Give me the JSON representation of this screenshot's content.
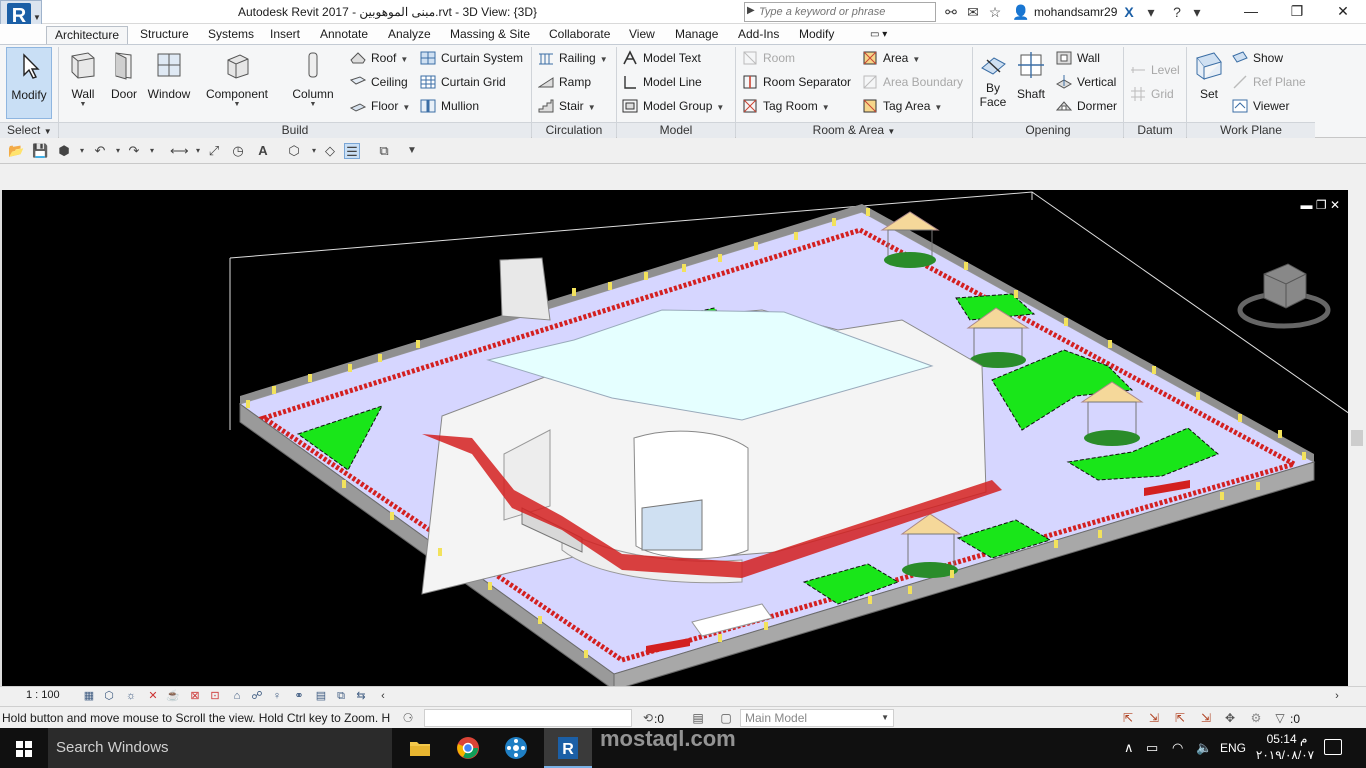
{
  "titlebar": {
    "title": "Autodesk Revit 2017 -     مبنى الموهوبين.rvt - 3D View: {3D}",
    "search_placeholder": "Type a keyword or phrase",
    "user": "mohandsamr29",
    "icons": [
      "binoculars-icon",
      "star-icon",
      "user-icon",
      "exchange-icon",
      "help-icon"
    ]
  },
  "ribbon": {
    "tabs": [
      "Architecture",
      "Structure",
      "Systems",
      "Insert",
      "Annotate",
      "Analyze",
      "Massing & Site",
      "Collaborate",
      "View",
      "Manage",
      "Add-Ins",
      "Modify"
    ],
    "active_tab": "Architecture",
    "select": {
      "modify": "Modify",
      "select": "Select"
    },
    "build": {
      "title": "Build",
      "wall": "Wall",
      "door": "Door",
      "window": "Window",
      "component": "Component",
      "column": "Column",
      "roof": "Roof",
      "ceiling": "Ceiling",
      "floor": "Floor",
      "curtain_system": "Curtain System",
      "curtain_grid": "Curtain Grid",
      "mullion": "Mullion"
    },
    "circulation": {
      "title": "Circulation",
      "railing": "Railing",
      "ramp": "Ramp",
      "stair": "Stair"
    },
    "model": {
      "title": "Model",
      "model_text": "Model Text",
      "model_line": "Model Line",
      "model_group": "Model Group"
    },
    "room_area": {
      "title": "Room & Area",
      "room": "Room",
      "room_separator": "Room Separator",
      "tag_room": "Tag Room",
      "area": "Area",
      "area_boundary": "Area Boundary",
      "tag_area": "Tag Area"
    },
    "opening": {
      "title": "Opening",
      "by_face": "By Face",
      "by_face_2": "Face",
      "by_face_1": "By",
      "shaft": "Shaft",
      "wall": "Wall",
      "vertical": "Vertical",
      "dormer": "Dormer"
    },
    "datum": {
      "title": "Datum",
      "level": "Level",
      "grid": "Grid"
    },
    "work_plane": {
      "title": "Work Plane",
      "set": "Set",
      "show": "Show",
      "ref_plane": "Ref Plane",
      "viewer": "Viewer"
    }
  },
  "view_control": {
    "scale": "1 : 100"
  },
  "status": {
    "message": "Hold button and move mouse to Scroll the view. Hold Ctrl key to Zoom. H",
    "coord": ":0",
    "model": "Main Model",
    "filter_count": ":0"
  },
  "taskbar": {
    "search": "Search Windows",
    "lang": "ENG",
    "time": "05:14 م",
    "date": "٢٠١٩/٠٨/٠٧"
  },
  "watermark": {
    "brand": "mostaql.com"
  },
  "colors": {
    "accent": "#1b5fa6",
    "viewport": "#000000",
    "lawn": "#19e619",
    "paving": "#d9d9ff",
    "wall": "#9a9a9a"
  }
}
